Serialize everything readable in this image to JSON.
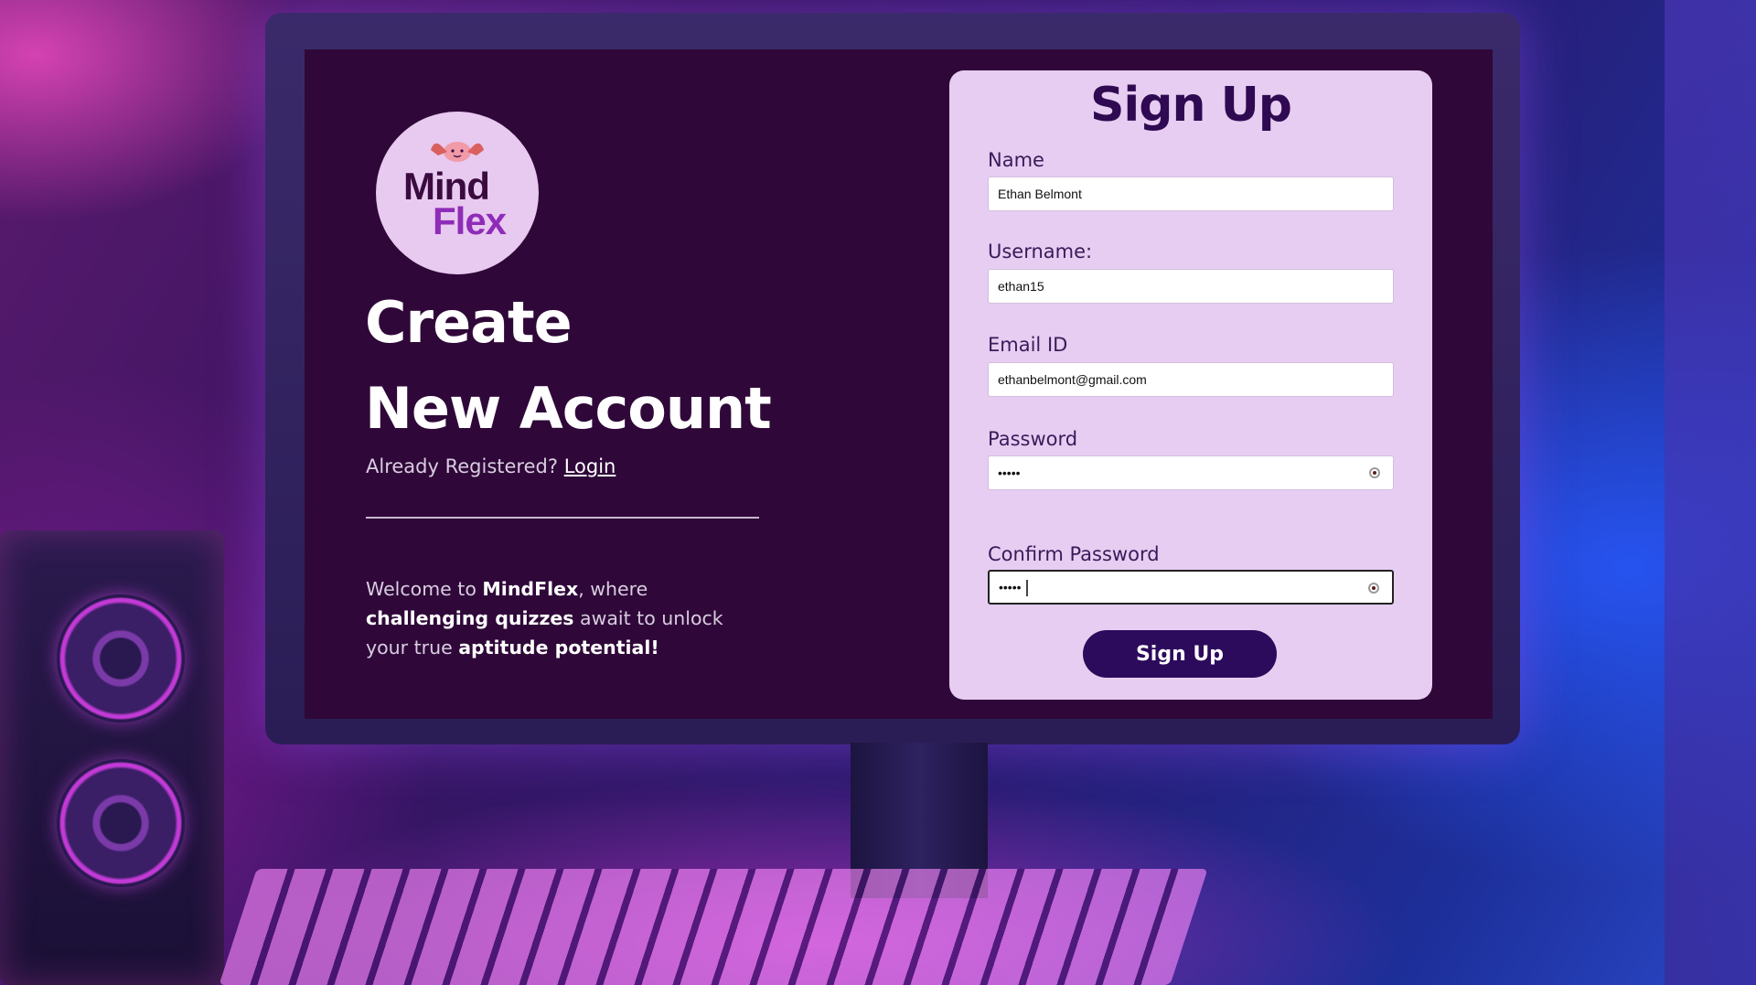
{
  "logo": {
    "line1": "Mind",
    "line2": "Flex"
  },
  "left": {
    "heading_line1": "Create",
    "heading_line2": "New Account",
    "already_text": "Already Registered?",
    "login_link": "Login",
    "welcome": {
      "part1": "Welcome to ",
      "brand": "MindFlex",
      "part2": ", where ",
      "bold2": "challenging quizzes",
      "part3": " await to unlock your true ",
      "bold3": "aptitude potential!"
    }
  },
  "form": {
    "title": "Sign Up",
    "name_label": "Name",
    "name_value": "Ethan Belmont",
    "username_label": "Username:",
    "username_value": "ethan15",
    "email_label": "Email ID",
    "email_value": "ethanbelmont@gmail.com",
    "password_label": "Password",
    "password_value": "•••••",
    "confirm_label": "Confirm Password",
    "confirm_value": "•••••",
    "submit_label": "Sign Up"
  },
  "colors": {
    "panel_bg": "#2f0839",
    "card_bg": "#e7cdf1",
    "button_bg": "#2c0a5c",
    "logo_bg": "#e8c9ef",
    "logo_accent": "#8e2cb8"
  }
}
